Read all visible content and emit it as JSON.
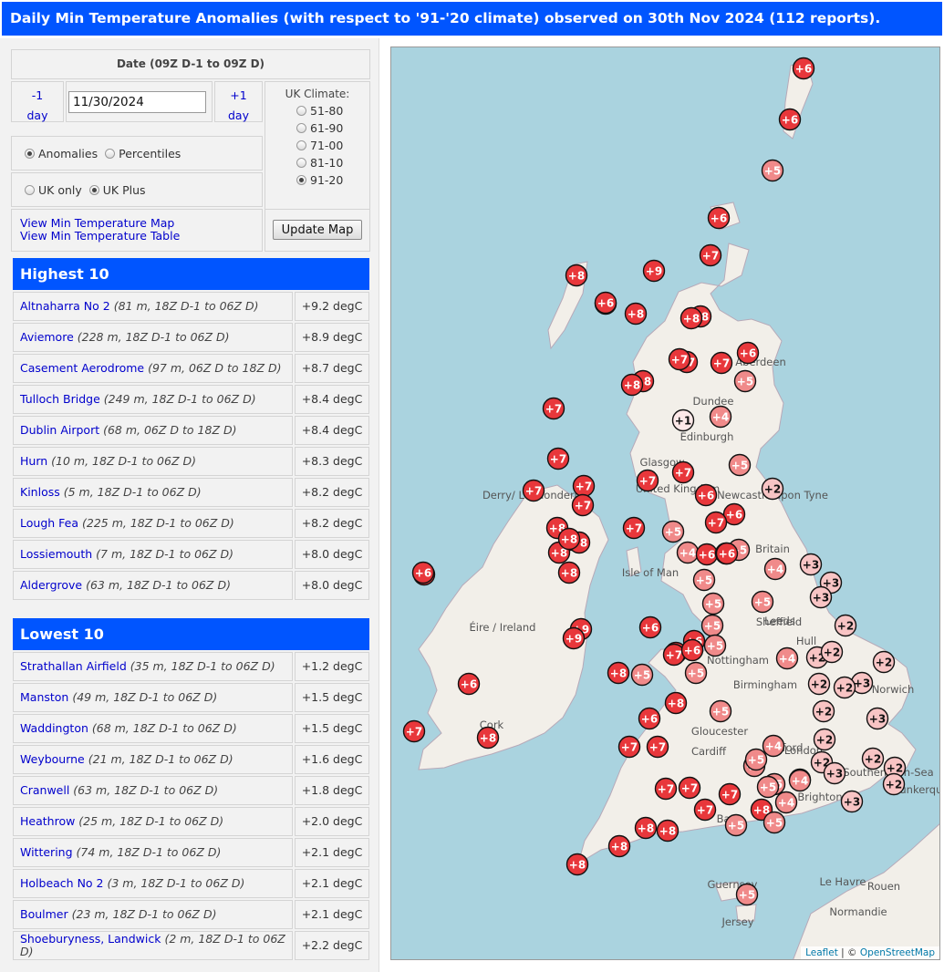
{
  "title": "Daily Min Temperature Anomalies (with respect to '91-'20 climate) observed on 30th Nov 2024 (112 reports).",
  "controls": {
    "date_header": "Date (09Z D-1 to 09Z D)",
    "prev_day_a": "-1",
    "prev_day_b": "day",
    "next_day_a": "+1",
    "next_day_b": "day",
    "date_value": "11/30/2024",
    "climate_title": "UK Climate:",
    "climate_options": [
      "51-80",
      "61-90",
      "71-00",
      "81-10",
      "91-20"
    ],
    "climate_selected": "91-20",
    "mode_options": [
      "Anomalies",
      "Percentiles"
    ],
    "mode_selected": "Anomalies",
    "region_options": [
      "UK only",
      "UK Plus"
    ],
    "region_selected": "UK Plus",
    "link_map": "View Min Temperature Map",
    "link_table": "View Min Temperature Table",
    "update_button": "Update Map"
  },
  "highest": {
    "heading": "Highest 10",
    "rows": [
      {
        "name": "Altnaharra No 2",
        "meta": "(81 m, 18Z D-1 to 06Z D)",
        "value": "+9.2 degC"
      },
      {
        "name": "Aviemore",
        "meta": "(228 m, 18Z D-1 to 06Z D)",
        "value": "+8.9 degC"
      },
      {
        "name": "Casement Aerodrome",
        "meta": "(97 m, 06Z D to 18Z D)",
        "value": "+8.7 degC"
      },
      {
        "name": "Tulloch Bridge",
        "meta": "(249 m, 18Z D-1 to 06Z D)",
        "value": "+8.4 degC"
      },
      {
        "name": "Dublin Airport",
        "meta": "(68 m, 06Z D to 18Z D)",
        "value": "+8.4 degC"
      },
      {
        "name": "Hurn",
        "meta": "(10 m, 18Z D-1 to 06Z D)",
        "value": "+8.3 degC"
      },
      {
        "name": "Kinloss",
        "meta": "(5 m, 18Z D-1 to 06Z D)",
        "value": "+8.2 degC"
      },
      {
        "name": "Lough Fea",
        "meta": "(225 m, 18Z D-1 to 06Z D)",
        "value": "+8.2 degC"
      },
      {
        "name": "Lossiemouth",
        "meta": "(7 m, 18Z D-1 to 06Z D)",
        "value": "+8.0 degC"
      },
      {
        "name": "Aldergrove",
        "meta": "(63 m, 18Z D-1 to 06Z D)",
        "value": "+8.0 degC"
      }
    ]
  },
  "lowest": {
    "heading": "Lowest 10",
    "rows": [
      {
        "name": "Strathallan Airfield",
        "meta": "(35 m, 18Z D-1 to 06Z D)",
        "value": "+1.2 degC"
      },
      {
        "name": "Manston",
        "meta": "(49 m, 18Z D-1 to 06Z D)",
        "value": "+1.5 degC"
      },
      {
        "name": "Waddington",
        "meta": "(68 m, 18Z D-1 to 06Z D)",
        "value": "+1.5 degC"
      },
      {
        "name": "Weybourne",
        "meta": "(21 m, 18Z D-1 to 06Z D)",
        "value": "+1.6 degC"
      },
      {
        "name": "Cranwell",
        "meta": "(63 m, 18Z D-1 to 06Z D)",
        "value": "+1.8 degC"
      },
      {
        "name": "Heathrow",
        "meta": "(25 m, 18Z D-1 to 06Z D)",
        "value": "+2.0 degC"
      },
      {
        "name": "Wittering",
        "meta": "(74 m, 18Z D-1 to 06Z D)",
        "value": "+2.1 degC"
      },
      {
        "name": "Holbeach No 2",
        "meta": "(3 m, 18Z D-1 to 06Z D)",
        "value": "+2.1 degC"
      },
      {
        "name": "Boulmer",
        "meta": "(23 m, 18Z D-1 to 06Z D)",
        "value": "+2.1 degC"
      },
      {
        "name": "Shoeburyness, Landwick",
        "meta": "(2 m, 18Z D-1 to 06Z D)",
        "value": "+2.2 degC"
      }
    ]
  },
  "map": {
    "attribution_leaflet": "Leaflet",
    "attribution_sep": " | © ",
    "attribution_osm": "OpenStreetMap",
    "place_labels": [
      "Aberdeen",
      "Dundee",
      "Edinburgh",
      "Glasgow",
      "United Kingdom",
      "Newcastle upon Tyne",
      "Derry/ Londonderry",
      "Britain",
      "Isle of Man",
      "Éire / Ireland",
      "Leeds",
      "Sheffield",
      "Hull",
      "Nottingham",
      "Birmingham",
      "Norwich",
      "Cardiff",
      "Gloucester",
      "Oxford",
      "London",
      "Southend-on-Sea",
      "Brighton",
      "Bath",
      "Cork",
      "Le Havre",
      "Rouen",
      "Normandie",
      "Guernsey",
      "Jersey",
      "Dunkerque"
    ],
    "colors": {
      "high": "#e8373b",
      "mid": "#f08a8a",
      "low": "#f8c4c4",
      "vlow": "#fde8e8"
    },
    "stations": [
      {
        "label": "+6",
        "tier": "high"
      },
      {
        "label": "+6",
        "tier": "high"
      },
      {
        "label": "+5",
        "tier": "mid"
      },
      {
        "label": "+6",
        "tier": "high"
      },
      {
        "label": "+7",
        "tier": "high"
      },
      {
        "label": "+8",
        "tier": "high"
      },
      {
        "label": "+9",
        "tier": "high"
      },
      {
        "label": "+8",
        "tier": "high"
      },
      {
        "label": "+8",
        "tier": "high"
      },
      {
        "label": "+8",
        "tier": "high"
      },
      {
        "label": "+8",
        "tier": "high"
      },
      {
        "label": "+6",
        "tier": "high"
      },
      {
        "label": "+7",
        "tier": "high"
      },
      {
        "label": "+7",
        "tier": "high"
      },
      {
        "label": "+7",
        "tier": "high"
      },
      {
        "label": "+5",
        "tier": "mid"
      },
      {
        "label": "+8",
        "tier": "high"
      },
      {
        "label": "+8",
        "tier": "high"
      },
      {
        "label": "+7",
        "tier": "high"
      },
      {
        "label": "+1",
        "tier": "vlow"
      },
      {
        "label": "+4",
        "tier": "mid"
      },
      {
        "label": "+5",
        "tier": "mid"
      },
      {
        "label": "+2",
        "tier": "low"
      },
      {
        "label": "+7",
        "tier": "high"
      },
      {
        "label": "+7",
        "tier": "high"
      },
      {
        "label": "+7",
        "tier": "high"
      },
      {
        "label": "+7",
        "tier": "high"
      },
      {
        "label": "+7",
        "tier": "high"
      },
      {
        "label": "+6",
        "tier": "high"
      },
      {
        "label": "+6",
        "tier": "high"
      },
      {
        "label": "+7",
        "tier": "high"
      },
      {
        "label": "+7",
        "tier": "high"
      },
      {
        "label": "+5",
        "tier": "mid"
      },
      {
        "label": "+8",
        "tier": "high"
      },
      {
        "label": "+8",
        "tier": "high"
      },
      {
        "label": "+8",
        "tier": "high"
      },
      {
        "label": "+4",
        "tier": "mid"
      },
      {
        "label": "+6",
        "tier": "high"
      },
      {
        "label": "+6",
        "tier": "high"
      },
      {
        "label": "+5",
        "tier": "mid"
      },
      {
        "label": "+6",
        "tier": "high"
      },
      {
        "label": "+8",
        "tier": "high"
      },
      {
        "label": "+4",
        "tier": "mid"
      },
      {
        "label": "+3",
        "tier": "low"
      },
      {
        "label": "+3",
        "tier": "low"
      },
      {
        "label": "+3",
        "tier": "low"
      },
      {
        "label": "+5",
        "tier": "mid"
      },
      {
        "label": "+5",
        "tier": "mid"
      },
      {
        "label": "+5",
        "tier": "mid"
      },
      {
        "label": "+2",
        "tier": "low"
      },
      {
        "label": "+9",
        "tier": "high"
      },
      {
        "label": "+6",
        "tier": "high"
      },
      {
        "label": "+5",
        "tier": "mid"
      },
      {
        "label": "+6",
        "tier": "high"
      },
      {
        "label": "+7",
        "tier": "high"
      },
      {
        "label": "+5",
        "tier": "mid"
      },
      {
        "label": "+7",
        "tier": "high"
      },
      {
        "label": "+6",
        "tier": "high"
      },
      {
        "label": "+5",
        "tier": "mid"
      },
      {
        "label": "+4",
        "tier": "mid"
      },
      {
        "label": "+2",
        "tier": "low"
      },
      {
        "label": "+2",
        "tier": "low"
      },
      {
        "label": "+2",
        "tier": "low"
      },
      {
        "label": "+2",
        "tier": "low"
      },
      {
        "label": "+3",
        "tier": "low"
      },
      {
        "label": "+2",
        "tier": "low"
      },
      {
        "label": "+8",
        "tier": "high"
      },
      {
        "label": "+5",
        "tier": "mid"
      },
      {
        "label": "+6",
        "tier": "high"
      },
      {
        "label": "+5",
        "tier": "mid"
      },
      {
        "label": "+2",
        "tier": "low"
      },
      {
        "label": "+3",
        "tier": "low"
      },
      {
        "label": "+7",
        "tier": "high"
      },
      {
        "label": "+7",
        "tier": "high"
      },
      {
        "label": "+6",
        "tier": "high"
      },
      {
        "label": "+5",
        "tier": "mid"
      },
      {
        "label": "+4",
        "tier": "mid"
      },
      {
        "label": "+2",
        "tier": "low"
      },
      {
        "label": "+5",
        "tier": "mid"
      },
      {
        "label": "+2",
        "tier": "low"
      },
      {
        "label": "+3",
        "tier": "low"
      },
      {
        "label": "+2",
        "tier": "low"
      },
      {
        "label": "+2",
        "tier": "low"
      },
      {
        "label": "+2",
        "tier": "low"
      },
      {
        "label": "+7",
        "tier": "high"
      },
      {
        "label": "+7",
        "tier": "high"
      },
      {
        "label": "+7",
        "tier": "high"
      },
      {
        "label": "+7",
        "tier": "high"
      },
      {
        "label": "+5",
        "tier": "mid"
      },
      {
        "label": "+5",
        "tier": "mid"
      },
      {
        "label": "+8",
        "tier": "high"
      },
      {
        "label": "+4",
        "tier": "mid"
      },
      {
        "label": "+4",
        "tier": "mid"
      },
      {
        "label": "+8",
        "tier": "high"
      },
      {
        "label": "+8",
        "tier": "high"
      },
      {
        "label": "+5",
        "tier": "mid"
      },
      {
        "label": "+5",
        "tier": "mid"
      },
      {
        "label": "+8",
        "tier": "high"
      },
      {
        "label": "+5",
        "tier": "mid"
      },
      {
        "label": "+4",
        "tier": "mid"
      },
      {
        "label": "+3",
        "tier": "low"
      },
      {
        "label": "+6",
        "tier": "high"
      },
      {
        "label": "+7",
        "tier": "high"
      },
      {
        "label": "+8",
        "tier": "high"
      },
      {
        "label": "+6",
        "tier": "high"
      },
      {
        "label": "+7",
        "tier": "high"
      },
      {
        "label": "+8",
        "tier": "high"
      },
      {
        "label": "+6",
        "tier": "high"
      },
      {
        "label": "+9",
        "tier": "high"
      },
      {
        "label": "+8",
        "tier": "high"
      },
      {
        "label": "+8",
        "tier": "high"
      },
      {
        "label": "+8",
        "tier": "high"
      }
    ]
  }
}
